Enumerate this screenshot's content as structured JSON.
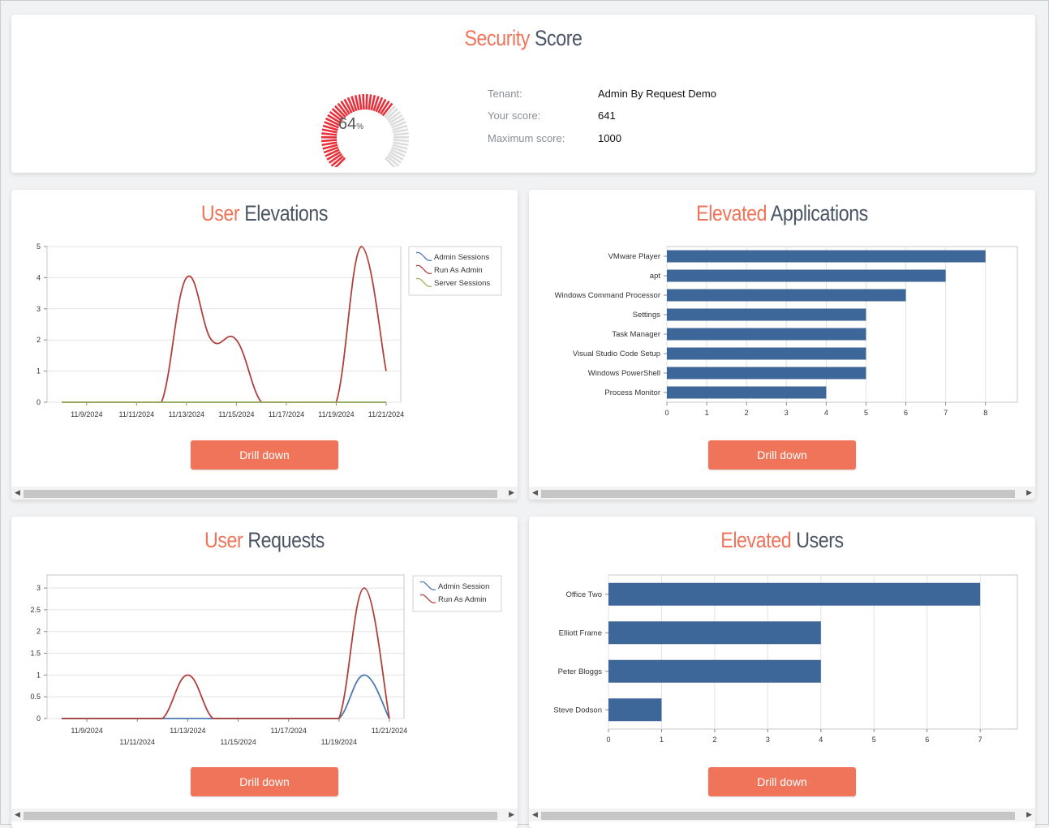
{
  "security": {
    "title_accent": "Security",
    "title_rest": "Score",
    "gauge": {
      "percent": 64,
      "percent_label": "64",
      "unit": "%"
    },
    "tenant_label": "Tenant:",
    "tenant_value": "Admin By Request Demo",
    "score_label": "Your score:",
    "score_value": "641",
    "max_label": "Maximum score:",
    "max_value": "1000",
    "colors": {
      "filled": "#e8303a",
      "empty": "#dcdcdc"
    }
  },
  "user_elevations": {
    "title_accent": "User",
    "title_rest": "Elevations",
    "button": "Drill down"
  },
  "elevated_applications": {
    "title_accent": "Elevated",
    "title_rest": "Applications",
    "button": "Drill down"
  },
  "user_requests": {
    "title_accent": "User",
    "title_rest": "Requests",
    "button": "Drill down"
  },
  "elevated_users": {
    "title_accent": "Elevated",
    "title_rest": "Users",
    "button": "Drill down"
  },
  "chart_data": [
    {
      "id": "user-elevations",
      "type": "line",
      "x": [
        "11/8/2024",
        "11/9/2024",
        "11/10/2024",
        "11/11/2024",
        "11/12/2024",
        "11/13/2024",
        "11/14/2024",
        "11/15/2024",
        "11/16/2024",
        "11/17/2024",
        "11/18/2024",
        "11/19/2024",
        "11/20/2024",
        "11/21/2024"
      ],
      "tick_labels": [
        "11/9/2024",
        "11/11/2024",
        "11/13/2024",
        "11/15/2024",
        "11/17/2024",
        "11/19/2024",
        "11/21/2024"
      ],
      "series": [
        {
          "name": "Admin Sessions",
          "color": "#4a78b0",
          "values": [
            0,
            0,
            0,
            0,
            0,
            0,
            0,
            0,
            0,
            0,
            0,
            0,
            0,
            0
          ]
        },
        {
          "name": "Run As Admin",
          "color": "#b0403c",
          "values": [
            0,
            0,
            0,
            0,
            0,
            4,
            2,
            2,
            0,
            0,
            0,
            0,
            5,
            1
          ]
        },
        {
          "name": "Server Sessions",
          "color": "#9bb35a",
          "values": [
            0,
            0,
            0,
            0,
            0,
            0,
            0,
            0,
            0,
            0,
            0,
            0,
            0,
            0
          ]
        }
      ],
      "ylim": [
        0,
        5
      ],
      "yticks": [
        "0",
        "1",
        "2",
        "3",
        "4",
        "5"
      ],
      "legend": "top-right"
    },
    {
      "id": "elevated-applications",
      "type": "bar",
      "orientation": "horizontal",
      "categories": [
        "VMware Player",
        "apt",
        "Windows Command Processor",
        "Settings",
        "Task Manager",
        "Visual Studio Code Setup",
        "Windows PowerShell",
        "Process Monitor"
      ],
      "values": [
        8,
        7,
        6,
        5,
        5,
        5,
        5,
        4
      ],
      "xlim": [
        0,
        8.8
      ],
      "xticks": [
        "0",
        "1",
        "2",
        "3",
        "4",
        "5",
        "6",
        "7",
        "8"
      ],
      "color": "#3d6699"
    },
    {
      "id": "user-requests",
      "type": "line",
      "x": [
        "11/8/2024",
        "11/9/2024",
        "11/10/2024",
        "11/11/2024",
        "11/12/2024",
        "11/13/2024",
        "11/14/2024",
        "11/15/2024",
        "11/16/2024",
        "11/17/2024",
        "11/18/2024",
        "11/19/2024",
        "11/20/2024",
        "11/21/2024"
      ],
      "tick_labels_upper": [
        "11/9/2024",
        "11/13/2024",
        "11/17/2024",
        "11/21/2024"
      ],
      "tick_labels_lower": [
        "11/11/2024",
        "11/15/2024",
        "11/19/2024"
      ],
      "series": [
        {
          "name": "Admin Session",
          "color": "#4a78b0",
          "values": [
            0,
            0,
            0,
            0,
            0,
            0,
            0,
            0,
            0,
            0,
            0,
            0,
            1,
            0
          ]
        },
        {
          "name": "Run As Admin",
          "color": "#b0403c",
          "values": [
            0,
            0,
            0,
            0,
            0,
            1,
            0,
            0,
            0,
            0,
            0,
            0,
            3,
            0
          ]
        }
      ],
      "ylim": [
        0,
        3.3
      ],
      "yticks": [
        "0",
        "0.5",
        "1",
        "1.5",
        "2",
        "2.5",
        "3"
      ],
      "legend": "top-right"
    },
    {
      "id": "elevated-users",
      "type": "bar",
      "orientation": "horizontal",
      "categories": [
        "Office Two",
        "Elliott Frame",
        "Peter Bloggs",
        "Steve Dodson"
      ],
      "values": [
        7,
        4,
        4,
        1
      ],
      "xlim": [
        0,
        7.7
      ],
      "xticks": [
        "0",
        "1",
        "2",
        "3",
        "4",
        "5",
        "6",
        "7"
      ],
      "color": "#3d6699"
    }
  ]
}
